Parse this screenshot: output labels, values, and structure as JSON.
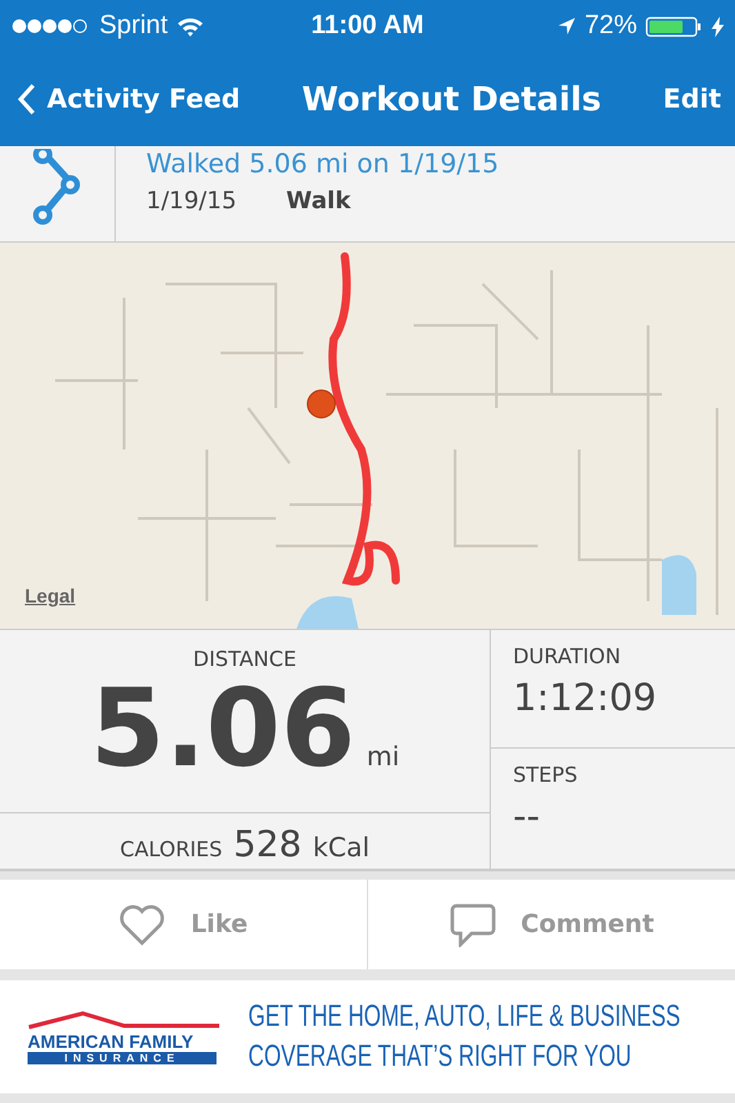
{
  "status_bar": {
    "carrier": "Sprint",
    "time": "11:00 AM",
    "battery": "72%"
  },
  "nav": {
    "back": "Activity Feed",
    "title": "Workout Details",
    "action": "Edit"
  },
  "summary": {
    "title": "Walked 5.06 mi on 1/19/15",
    "date": "1/19/15",
    "type": "Walk"
  },
  "map": {
    "kind": "picture",
    "legal": "Legal"
  },
  "stats": {
    "distance": {
      "label": "DISTANCE",
      "value": "5.06",
      "unit": "mi"
    },
    "calories": {
      "label": "CALORIES",
      "value": "528",
      "unit": "kCal"
    },
    "duration": {
      "label": "DURATION",
      "value": "1:12:09"
    },
    "steps": {
      "label": "STEPS",
      "value": "--"
    }
  },
  "actions": [
    {
      "kind": "like",
      "label": "Like"
    },
    {
      "kind": "comment",
      "label": "Comment"
    }
  ],
  "ad": {
    "brand": "AMERICAN FAMILY",
    "brand_sub": "INSURANCE",
    "lines": [
      "GET THE HOME, AUTO, LIFE & BUSINESS",
      "COVERAGE THAT’S RIGHT FOR YOU"
    ]
  }
}
